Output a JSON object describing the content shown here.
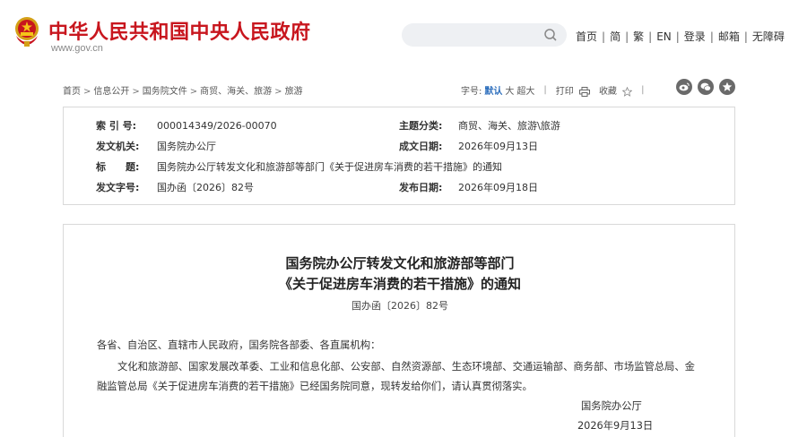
{
  "header": {
    "site_title": "中华人民共和国中央人民政府",
    "site_url": "www.gov.cn",
    "search_placeholder": "",
    "nav": [
      "首页",
      "简",
      "繁",
      "EN",
      "登录",
      "邮箱",
      "无障碍"
    ]
  },
  "breadcrumb": [
    "首页",
    "信息公开",
    "国务院文件",
    "商贸、海关、旅游",
    "旅游"
  ],
  "toolbar": {
    "font_label": "字号:",
    "font_default": "默认",
    "font_large": "大",
    "font_xlarge": "超大",
    "print": "打印",
    "collect": "收藏"
  },
  "share_icons": [
    "weibo-icon",
    "wechat-icon",
    "qzone-icon"
  ],
  "meta": {
    "index_label": "索 引 号:",
    "index_value": "000014349/2026-00070",
    "topic_label": "主题分类:",
    "topic_value": "商贸、海关、旅游\\旅游",
    "issuer_label": "发文机关:",
    "issuer_value": "国务院办公厅",
    "created_label": "成文日期:",
    "created_value": "2026年09月13日",
    "title_label": "标　　题:",
    "title_value": "国务院办公厅转发文化和旅游部等部门《关于促进房车消费的若干措施》的通知",
    "docno_label": "发文字号:",
    "docno_value": "国办函〔2026〕82号",
    "published_label": "发布日期:",
    "published_value": "2026年09月18日"
  },
  "document": {
    "title_line1": "国务院办公厅转发文化和旅游部等部门",
    "title_line2": "《关于促进房车消费的若干措施》的通知",
    "doc_number": "国办函〔2026〕82号",
    "salutation": "各省、自治区、直辖市人民政府，国务院各部委、各直属机构：",
    "body_line1": "文化和旅游部、国家发展改革委、工业和信息化部、公安部、自然资源部、生态环境部、交通运输部、商务部、市场监管总局、金",
    "body_line2": "融监管总局《关于促进房车消费的若干措施》已经国务院同意，现转发给你们，请认真贯彻落实。",
    "signature": "国务院办公厅",
    "date": "2026年9月13日"
  },
  "colors": {
    "brand_red": "#c8161e",
    "link_blue": "#2e6fbd",
    "border": "#d9d9d9"
  }
}
